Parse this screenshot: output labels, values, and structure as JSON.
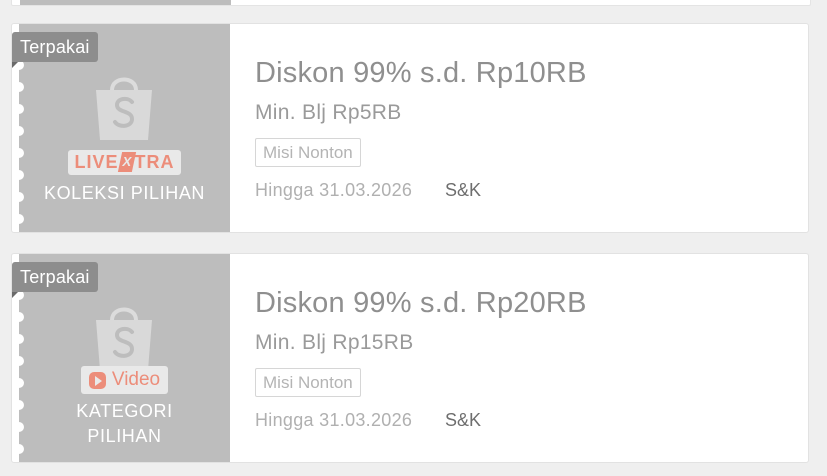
{
  "vouchers": [
    {
      "badge": "Terpakai",
      "brand_type": "livextra",
      "brand_live": "LIVE",
      "brand_x": "X",
      "brand_tra": "TRA",
      "category": [
        "KOLEKSI PILIHAN"
      ],
      "title": "Diskon 99% s.d. Rp10RB",
      "min_purchase": "Min. Blj Rp5RB",
      "tag": "Misi Nonton",
      "valid_until": "Hingga 31.03.2026",
      "terms_link": "S&K"
    },
    {
      "badge": "Terpakai",
      "brand_type": "video",
      "brand_video": "Video",
      "category": [
        "KATEGORI",
        "PILIHAN"
      ],
      "title": "Diskon 99% s.d. Rp20RB",
      "min_purchase": "Min. Blj Rp15RB",
      "tag": "Misi Nonton",
      "valid_until": "Hingga 31.03.2026",
      "terms_link": "S&K"
    }
  ],
  "colors": {
    "stub": "#bdbdbd",
    "badge": "#8d8d8d",
    "brand_accent": "#ec8d7a",
    "title_text": "#8f8f8f"
  },
  "icons": [
    "shopee-bag-icon",
    "video-play-icon"
  ]
}
